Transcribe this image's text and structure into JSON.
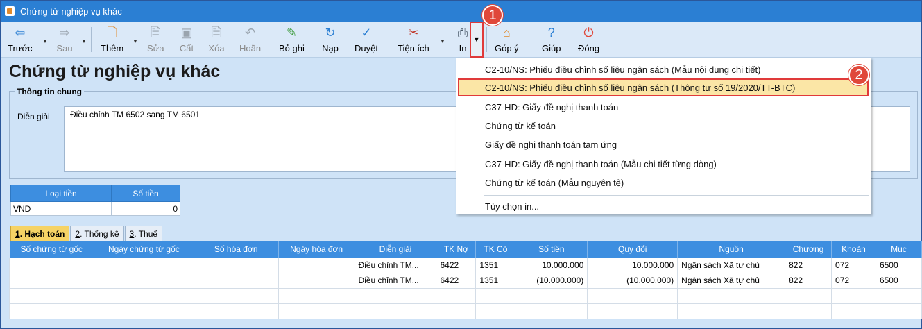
{
  "window": {
    "title": "Chứng từ nghiệp vụ khác"
  },
  "toolbar": {
    "back": "Trước",
    "forward": "Sau",
    "add": "Thêm",
    "edit": "Sửa",
    "save": "Cất",
    "delete": "Xóa",
    "undo": "Hoãn",
    "unpost": "Bỏ ghi",
    "reload": "Nạp",
    "approve": "Duyệt",
    "utilities": "Tiện ích",
    "print": "In",
    "feedback": "Góp ý",
    "help": "Giúp",
    "close": "Đóng"
  },
  "callouts": {
    "one": "1",
    "two": "2"
  },
  "page": {
    "title": "Chứng từ nghiệp vụ khác"
  },
  "general_info": {
    "legend": "Thông tin chung",
    "description_label": "Diễn giải",
    "description_value": "Điều chỉnh TM 6502 sang TM 6501"
  },
  "currency_table": {
    "headers": [
      "Loại tiền",
      "Số tiền"
    ],
    "row": {
      "currency": "VND",
      "amount": "0"
    }
  },
  "tabs": [
    {
      "key": "1",
      "label": ". Hạch toán"
    },
    {
      "key": "2",
      "label": ". Thống kê"
    },
    {
      "key": "3",
      "label": ". Thuế"
    }
  ],
  "grid": {
    "headers": [
      "Số chứng từ gốc",
      "Ngày chứng từ gốc",
      "Số hóa đơn",
      "Ngày hóa đơn",
      "Diễn giải",
      "TK Nợ",
      "TK Có",
      "Số tiền",
      "Quy đổi",
      "Nguồn",
      "Chương",
      "Khoản",
      "Mục"
    ],
    "rows": [
      [
        "",
        "",
        "",
        "",
        "Điều chỉnh TM...",
        "6422",
        "1351",
        "10.000.000",
        "10.000.000",
        "Ngân sách Xã tự chủ",
        "822",
        "072",
        "6500"
      ],
      [
        "",
        "",
        "",
        "",
        "Điều chỉnh TM...",
        "6422",
        "1351",
        "(10.000.000)",
        "(10.000.000)",
        "Ngân sách Xã tự chủ",
        "822",
        "072",
        "6500"
      ]
    ]
  },
  "print_menu": {
    "items": [
      "C2-10/NS: Phiếu điều chỉnh số liệu ngân sách (Mẫu nội dung chi tiết)",
      "C2-10/NS: Phiếu điều chỉnh số liệu ngân sách (Thông tư số 19/2020/TT-BTC)",
      "C37-HD: Giấy đề nghị thanh toán",
      "Chứng từ kế toán",
      "Giấy đề nghị thanh toán tạm ứng",
      "C37-HD: Giấy đề nghị thanh toán (Mẫu chi tiết từng dòng)",
      "Chứng từ kế toán (Mẫu nguyên tệ)"
    ],
    "options": "Tùy chọn in..."
  },
  "colors": {
    "titlebar": "#2b7fd3",
    "grid_header": "#3d8ee0",
    "highlight": "#fbe6a6",
    "callout": "#e0483a"
  }
}
